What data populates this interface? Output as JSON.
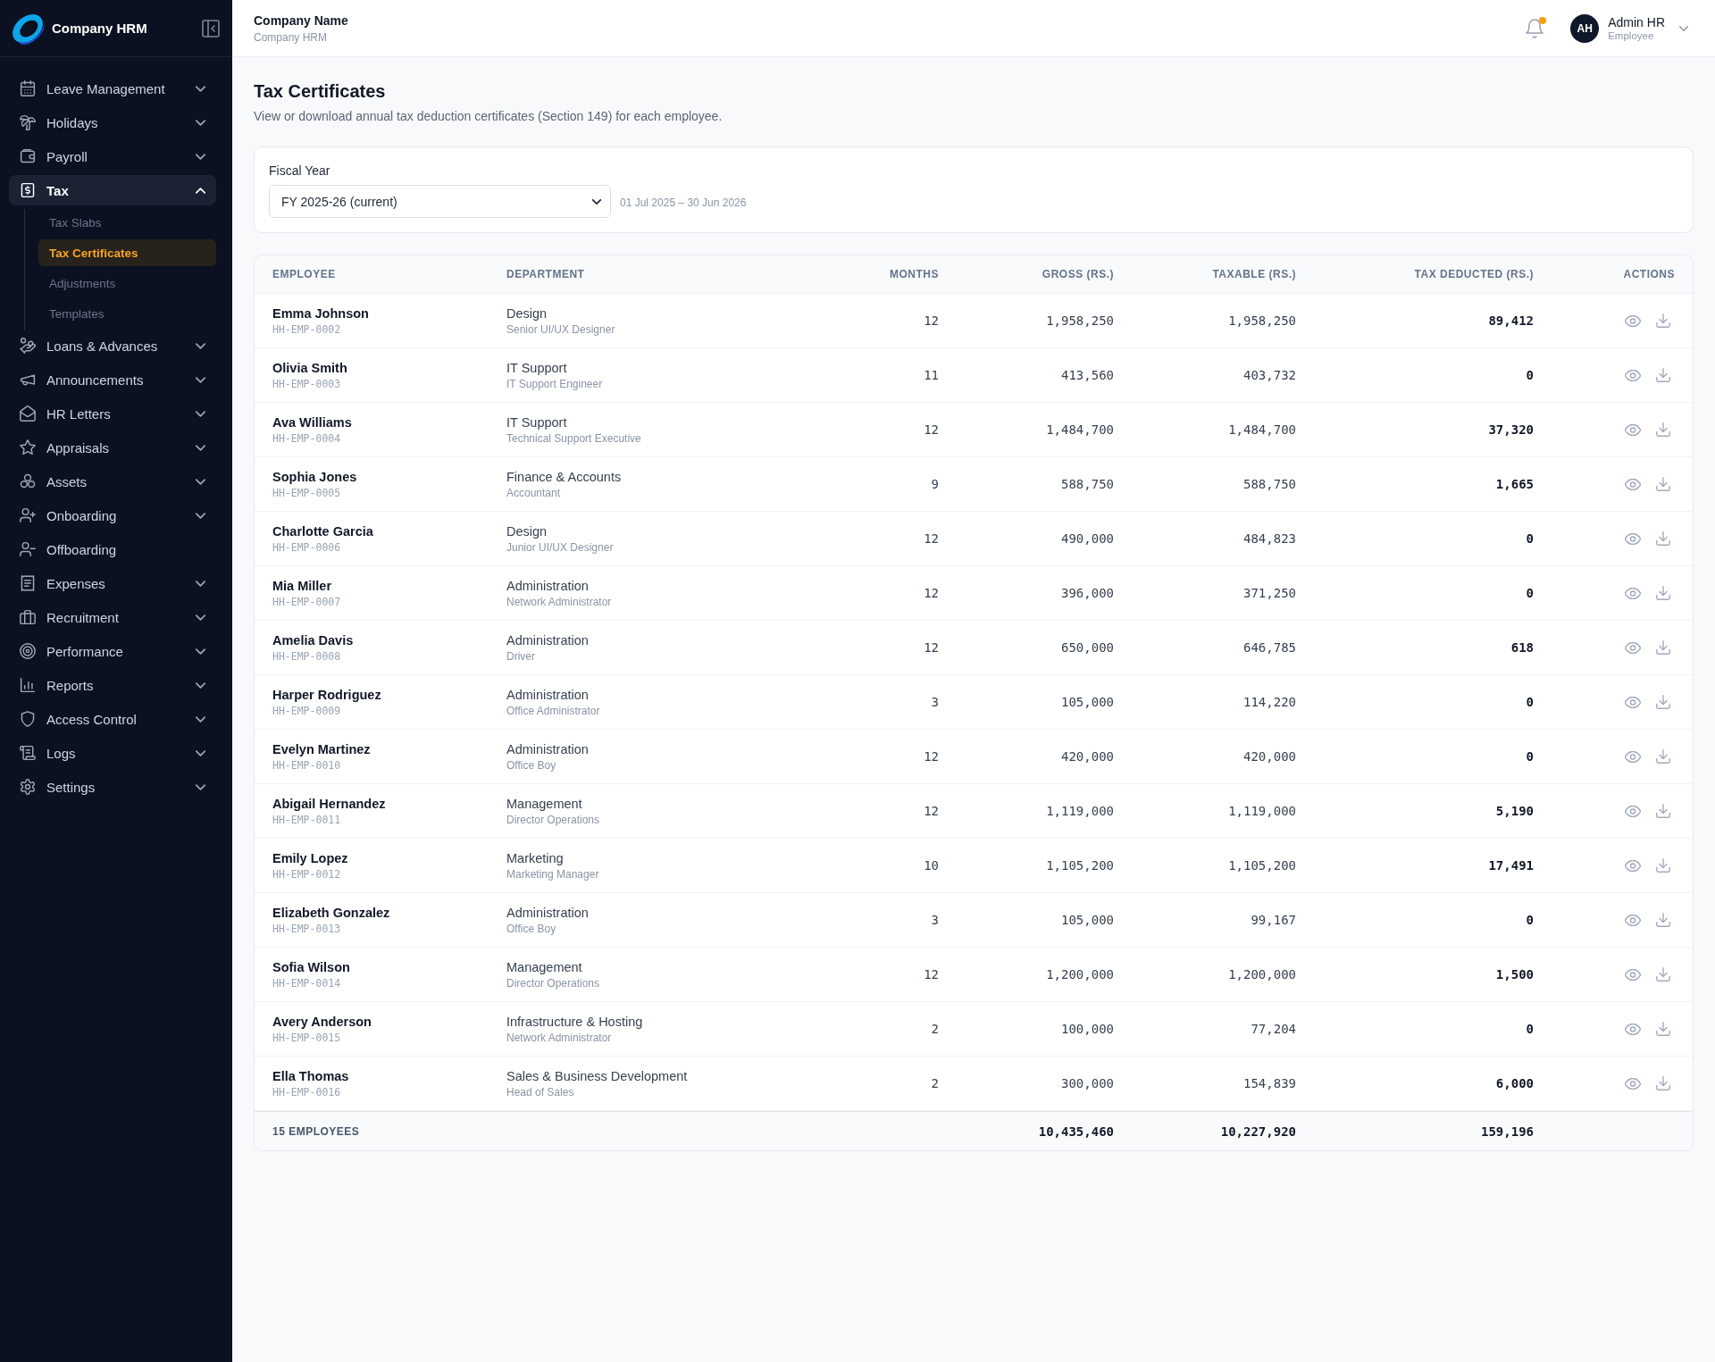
{
  "sidebar": {
    "brand": "Company HRM",
    "items": [
      {
        "label": "Leave Management",
        "kind": "group",
        "expanded": false,
        "selected": false
      },
      {
        "label": "Holidays",
        "kind": "group",
        "expanded": false,
        "selected": false
      },
      {
        "label": "Payroll",
        "kind": "group",
        "expanded": false,
        "selected": false
      },
      {
        "label": "Tax",
        "kind": "group",
        "expanded": true,
        "selected": true,
        "children": [
          {
            "label": "Tax Slabs",
            "selected": false
          },
          {
            "label": "Tax Certificates",
            "selected": true
          },
          {
            "label": "Adjustments",
            "selected": false
          },
          {
            "label": "Templates",
            "selected": false
          }
        ]
      },
      {
        "label": "Loans & Advances",
        "kind": "group",
        "expanded": false,
        "selected": false
      },
      {
        "label": "Announcements",
        "kind": "group",
        "expanded": false,
        "selected": false
      },
      {
        "label": "HR Letters",
        "kind": "group",
        "expanded": false,
        "selected": false
      },
      {
        "label": "Appraisals",
        "kind": "group",
        "expanded": false,
        "selected": false
      },
      {
        "label": "Assets",
        "kind": "group",
        "expanded": false,
        "selected": false
      },
      {
        "label": "Onboarding",
        "kind": "group",
        "expanded": false,
        "selected": false
      },
      {
        "label": "Offboarding",
        "kind": "link",
        "selected": false
      },
      {
        "label": "Expenses",
        "kind": "group",
        "expanded": false,
        "selected": false
      },
      {
        "label": "Recruitment",
        "kind": "group",
        "expanded": false,
        "selected": false
      },
      {
        "label": "Performance",
        "kind": "group",
        "expanded": false,
        "selected": false
      },
      {
        "label": "Reports",
        "kind": "group",
        "expanded": false,
        "selected": false
      },
      {
        "label": "Access Control",
        "kind": "group",
        "expanded": false,
        "selected": false
      },
      {
        "label": "Logs",
        "kind": "group",
        "expanded": false,
        "selected": false
      },
      {
        "label": "Settings",
        "kind": "group",
        "expanded": false,
        "selected": false
      }
    ]
  },
  "header": {
    "title": "Company Name",
    "subtitle": "Company HRM",
    "notifications": {
      "unread": true
    },
    "user": {
      "initials": "AH",
      "name": "Admin HR",
      "role": "Employee"
    }
  },
  "page": {
    "title": "Tax Certificates",
    "description": "View or download annual tax deduction certificates (Section 149) for each employee."
  },
  "filter": {
    "label": "Fiscal Year",
    "value": "FY 2025-26 (current)",
    "range": "01 Jul 2025 – 30 Jun 2026"
  },
  "table": {
    "columns": [
      "EMPLOYEE",
      "DEPARTMENT",
      "MONTHS",
      "GROSS (RS.)",
      "TAXABLE (RS.)",
      "TAX DEDUCTED (RS.)",
      "ACTIONS"
    ],
    "rows": [
      {
        "name": "Emma Johnson",
        "id": "HH-EMP-0002",
        "department": "Design",
        "role": "Senior UI/UX Designer",
        "months": "12",
        "gross": "1,958,250",
        "taxable": "1,958,250",
        "tax_deducted": "89,412"
      },
      {
        "name": "Olivia Smith",
        "id": "HH-EMP-0003",
        "department": "IT Support",
        "role": "IT Support Engineer",
        "months": "11",
        "gross": "413,560",
        "taxable": "403,732",
        "tax_deducted": "0"
      },
      {
        "name": "Ava Williams",
        "id": "HH-EMP-0004",
        "department": "IT Support",
        "role": "Technical Support Executive",
        "months": "12",
        "gross": "1,484,700",
        "taxable": "1,484,700",
        "tax_deducted": "37,320"
      },
      {
        "name": "Sophia Jones",
        "id": "HH-EMP-0005",
        "department": "Finance & Accounts",
        "role": "Accountant",
        "months": "9",
        "gross": "588,750",
        "taxable": "588,750",
        "tax_deducted": "1,665"
      },
      {
        "name": "Charlotte Garcia",
        "id": "HH-EMP-0006",
        "department": "Design",
        "role": "Junior UI/UX Designer",
        "months": "12",
        "gross": "490,000",
        "taxable": "484,823",
        "tax_deducted": "0"
      },
      {
        "name": "Mia Miller",
        "id": "HH-EMP-0007",
        "department": "Administration",
        "role": "Network Administrator",
        "months": "12",
        "gross": "396,000",
        "taxable": "371,250",
        "tax_deducted": "0"
      },
      {
        "name": "Amelia Davis",
        "id": "HH-EMP-0008",
        "department": "Administration",
        "role": "Driver",
        "months": "12",
        "gross": "650,000",
        "taxable": "646,785",
        "tax_deducted": "618"
      },
      {
        "name": "Harper Rodriguez",
        "id": "HH-EMP-0009",
        "department": "Administration",
        "role": "Office Administrator",
        "months": "3",
        "gross": "105,000",
        "taxable": "114,220",
        "tax_deducted": "0"
      },
      {
        "name": "Evelyn Martinez",
        "id": "HH-EMP-0010",
        "department": "Administration",
        "role": "Office Boy",
        "months": "12",
        "gross": "420,000",
        "taxable": "420,000",
        "tax_deducted": "0"
      },
      {
        "name": "Abigail Hernandez",
        "id": "HH-EMP-0011",
        "department": "Management",
        "role": "Director Operations",
        "months": "12",
        "gross": "1,119,000",
        "taxable": "1,119,000",
        "tax_deducted": "5,190"
      },
      {
        "name": "Emily Lopez",
        "id": "HH-EMP-0012",
        "department": "Marketing",
        "role": "Marketing Manager",
        "months": "10",
        "gross": "1,105,200",
        "taxable": "1,105,200",
        "tax_deducted": "17,491"
      },
      {
        "name": "Elizabeth Gonzalez",
        "id": "HH-EMP-0013",
        "department": "Administration",
        "role": "Office Boy",
        "months": "3",
        "gross": "105,000",
        "taxable": "99,167",
        "tax_deducted": "0"
      },
      {
        "name": "Sofia Wilson",
        "id": "HH-EMP-0014",
        "department": "Management",
        "role": "Director Operations",
        "months": "12",
        "gross": "1,200,000",
        "taxable": "1,200,000",
        "tax_deducted": "1,500"
      },
      {
        "name": "Avery Anderson",
        "id": "HH-EMP-0015",
        "department": "Infrastructure & Hosting",
        "role": "Network Administrator",
        "months": "2",
        "gross": "100,000",
        "taxable": "77,204",
        "tax_deducted": "0"
      },
      {
        "name": "Ella Thomas",
        "id": "HH-EMP-0016",
        "department": "Sales & Business Development",
        "role": "Head of Sales",
        "months": "2",
        "gross": "300,000",
        "taxable": "154,839",
        "tax_deducted": "6,000"
      }
    ],
    "footer": {
      "label": "15 EMPLOYEES",
      "gross": "10,435,460",
      "taxable": "10,227,920",
      "tax_deducted": "159,196"
    }
  }
}
